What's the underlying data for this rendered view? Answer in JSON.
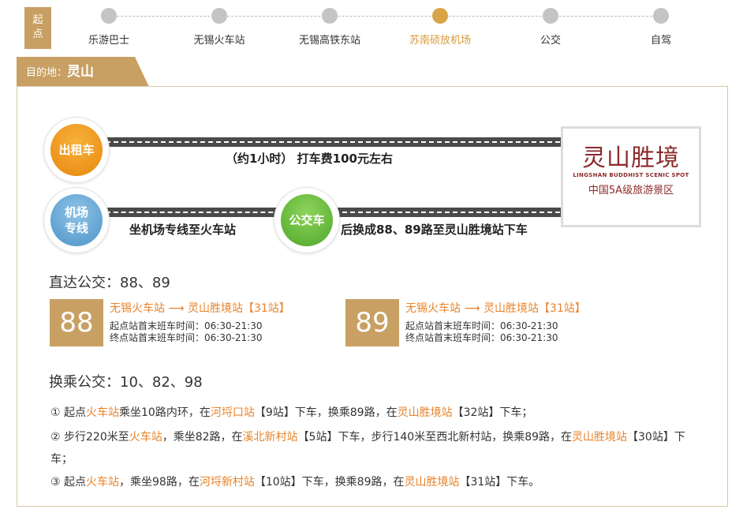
{
  "nav": {
    "start_label": [
      "起",
      "点"
    ],
    "steps": [
      {
        "label": "乐游巴士"
      },
      {
        "label": "无锡火车站"
      },
      {
        "label": "无锡高铁东站"
      },
      {
        "label": "苏南硕放机场"
      },
      {
        "label": "公交"
      },
      {
        "label": "自驾"
      }
    ],
    "active_index": 3
  },
  "destination": {
    "prefix": "目的地：",
    "name": "灵山"
  },
  "routes": {
    "taxi": {
      "icon_label": "出租车",
      "text": "（约1小时）  打车费100元左右"
    },
    "airport": {
      "icon_label": [
        "机场",
        "专线"
      ],
      "text": "坐机场专线至火车站"
    },
    "bus": {
      "icon_label": "公交车",
      "text": "后换成88、89路至灵山胜境站下车"
    }
  },
  "scenic": {
    "logo": "灵山胜境",
    "en": "LINGSHAN BUDDHIST SCENIC SPOT",
    "cn": "中国5A级旅游景区"
  },
  "direct": {
    "title": "直达公交：88、89",
    "buses": [
      {
        "number": "88",
        "route": "无锡火车站 ⟶ 灵山胜境站【31站】",
        "first": "起点站首末班车时间：06:30-21:30",
        "last": "终点站首末班车时间：06:30-21:30"
      },
      {
        "number": "89",
        "route": "无锡火车站 ⟶ 灵山胜境站【31站】",
        "first": "起点站首末班车时间：06:30-21:30",
        "last": "终点站首末班车时间：06:30-21:30"
      }
    ]
  },
  "transfer": {
    "title": "换乘公交：10、82、98",
    "items": [
      {
        "segments": [
          {
            "t": "① 起点",
            "hl": false
          },
          {
            "t": "火车站",
            "hl": true
          },
          {
            "t": "乘坐10路内环，在",
            "hl": false
          },
          {
            "t": "河埒口站",
            "hl": true
          },
          {
            "t": "【9站】下车，换乘89路，在",
            "hl": false
          },
          {
            "t": "灵山胜境站",
            "hl": true
          },
          {
            "t": "【32站】下车；",
            "hl": false
          }
        ]
      },
      {
        "segments": [
          {
            "t": "② 步行220米至",
            "hl": false
          },
          {
            "t": "火车站",
            "hl": true
          },
          {
            "t": "，乘坐82路，在",
            "hl": false
          },
          {
            "t": "溪北新村站",
            "hl": true
          },
          {
            "t": "【5站】下车，步行140米至西北新村站，换乘89路，在",
            "hl": false
          },
          {
            "t": "灵山胜境站",
            "hl": true
          },
          {
            "t": "【30站】下车；",
            "hl": false
          }
        ]
      },
      {
        "segments": [
          {
            "t": "③ 起点",
            "hl": false
          },
          {
            "t": "火车站",
            "hl": true
          },
          {
            "t": "，乘坐98路，在",
            "hl": false
          },
          {
            "t": "河埒新村站",
            "hl": true
          },
          {
            "t": "【10站】下车，换乘89路，在",
            "hl": false
          },
          {
            "t": "灵山胜境站",
            "hl": true
          },
          {
            "t": "【31站】下车。",
            "hl": false
          }
        ]
      }
    ]
  },
  "colors": {
    "gold": "#c8a063",
    "highlight": "#e8832a",
    "taxi": "#e8870f",
    "airport": "#4d94c9",
    "bus": "#4ea82a"
  }
}
